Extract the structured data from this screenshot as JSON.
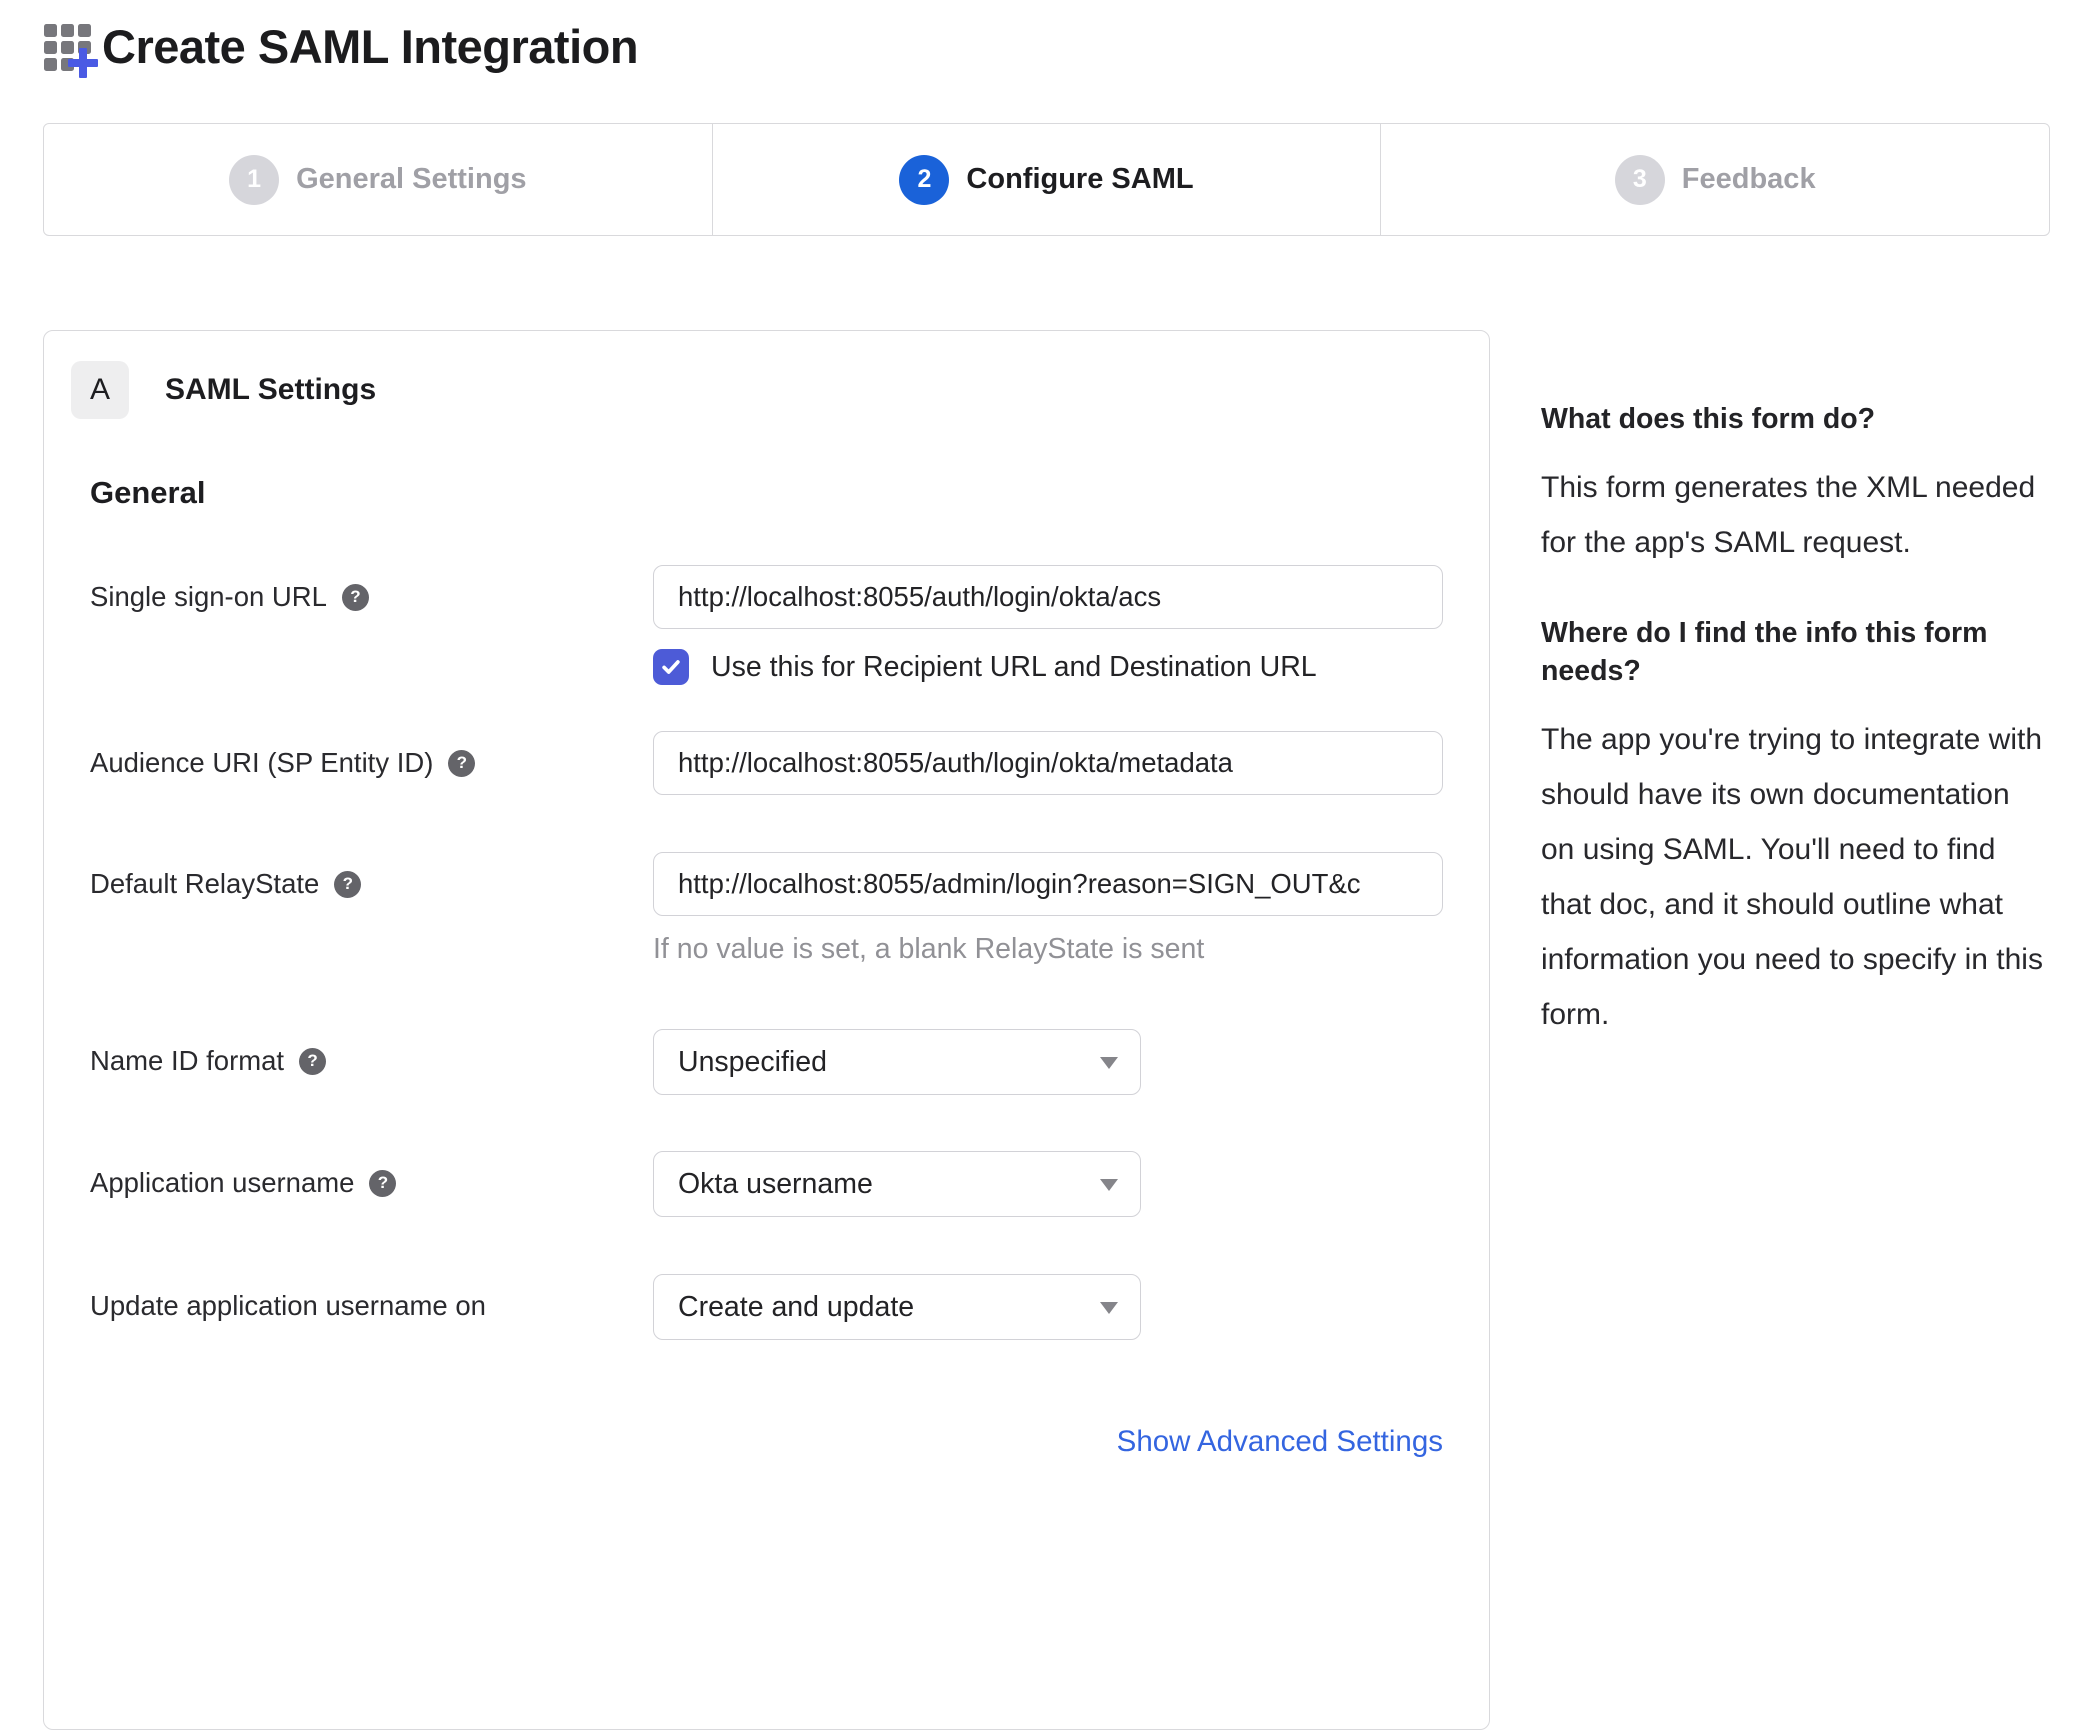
{
  "header": {
    "title": "Create SAML Integration",
    "icon": "grid-plus-icon"
  },
  "wizard": {
    "steps": [
      {
        "number": "1",
        "label": "General Settings",
        "state": "inactive"
      },
      {
        "number": "2",
        "label": "Configure SAML",
        "state": "active"
      },
      {
        "number": "3",
        "label": "Feedback",
        "state": "inactive"
      }
    ]
  },
  "panel": {
    "section_badge": "A",
    "section_title": "SAML Settings",
    "group_title": "General",
    "fields": [
      {
        "label": "Single sign-on URL",
        "has_help": true,
        "type": "text",
        "value": "http://localhost:8055/auth/login/okta/acs",
        "checkbox_checked": true,
        "checkbox_label": "Use this for Recipient URL and Destination URL"
      },
      {
        "label": "Audience URI (SP Entity ID)",
        "has_help": true,
        "type": "text",
        "value": "http://localhost:8055/auth/login/okta/metadata"
      },
      {
        "label": "Default RelayState",
        "has_help": true,
        "type": "text",
        "value": "http://localhost:8055/admin/login?reason=SIGN_OUT&c",
        "helper": "If no value is set, a blank RelayState is sent"
      },
      {
        "label": "Name ID format",
        "has_help": true,
        "type": "select",
        "value": "Unspecified"
      },
      {
        "label": "Application username",
        "has_help": true,
        "type": "select",
        "value": "Okta username"
      },
      {
        "label": "Update application username on",
        "has_help": false,
        "type": "select",
        "value": "Create and update"
      }
    ],
    "advanced_link": "Show Advanced Settings"
  },
  "sidebar": {
    "sections": [
      {
        "heading": "What does this form do?",
        "body": "This form generates the XML needed for the app's SAML request."
      },
      {
        "heading": "Where do I find the info this form needs?",
        "body": "The app you're trying to integrate with should have its own documentation on using SAML. You'll need to find that doc, and it should outline what information you need to specify in this form."
      }
    ]
  },
  "icons": {
    "help_glyph": "?"
  },
  "colors": {
    "active_step_blue": "#1a62d9",
    "checkbox_indigo": "#4d5bd7",
    "link_blue": "#3465e0",
    "plus_icon_blue": "#4a5ae4",
    "inactive_gray": "#d6d6db",
    "border_gray": "#d9d9dc",
    "helper_gray": "#919196"
  }
}
